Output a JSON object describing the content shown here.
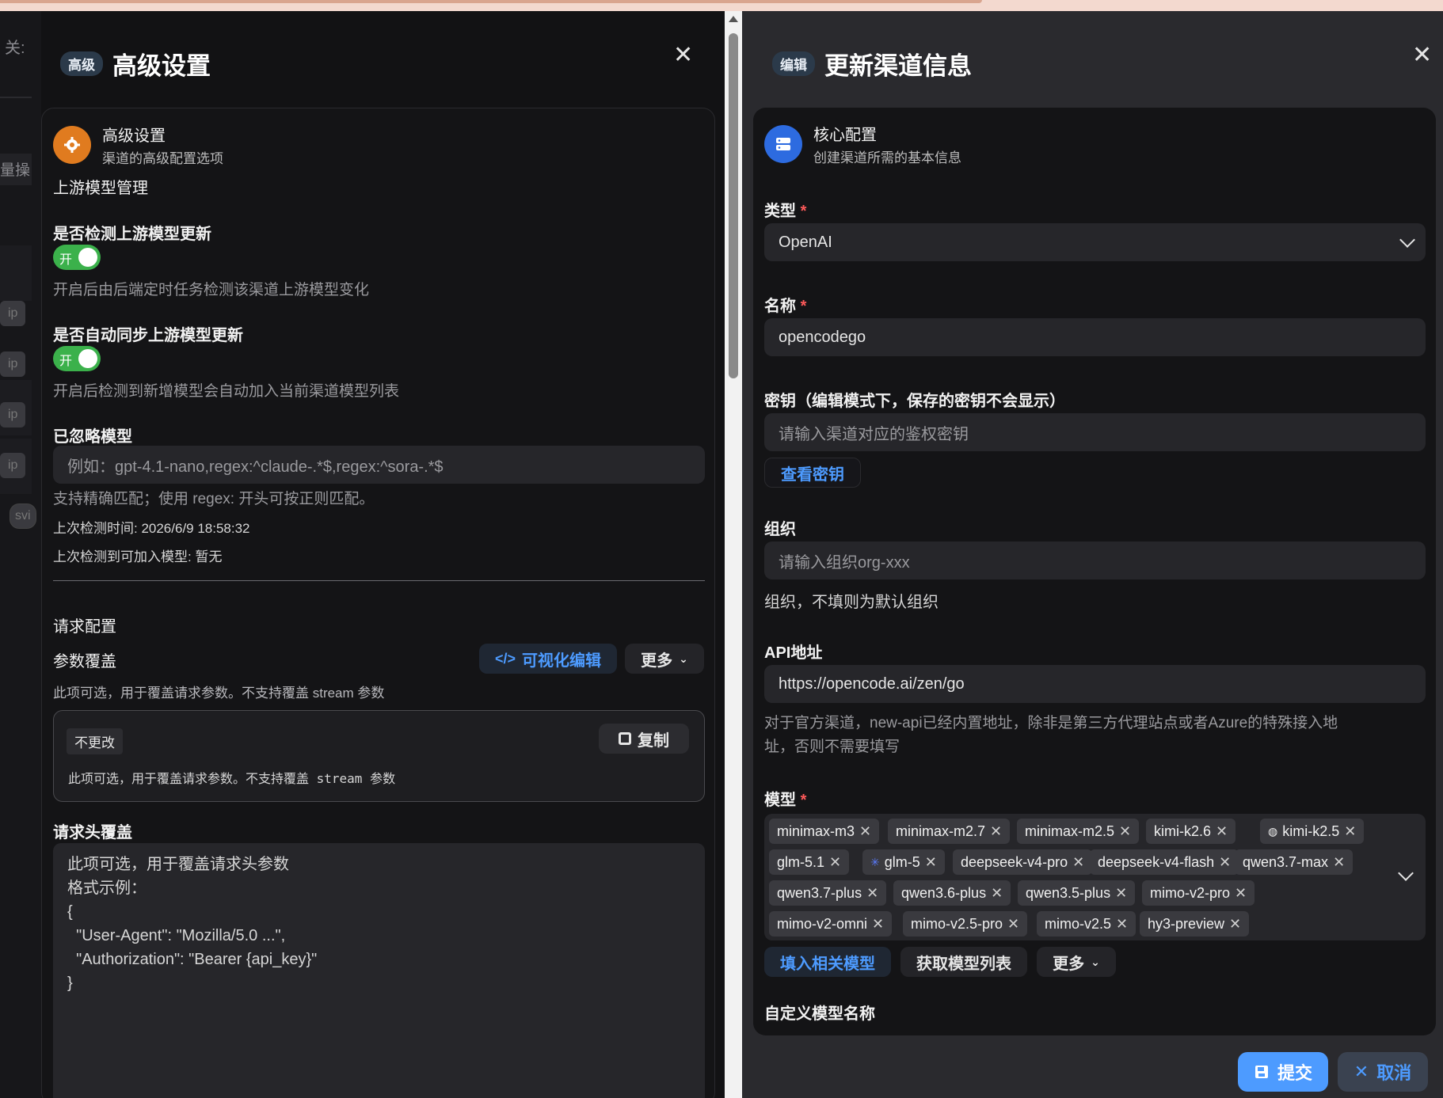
{
  "bg_app": {
    "title_frag": "关:",
    "side_frag": "量操",
    "chips": [
      "ip",
      "ip",
      "ip",
      "ip",
      "svi"
    ]
  },
  "left": {
    "tag": "高级",
    "title": "高级设置",
    "card_title": "高级设置",
    "card_sub": "渠道的高级配置选项",
    "upstream_section": "上游模型管理",
    "detect_label": "是否检测上游模型更新",
    "detect_toggle": "开",
    "detect_hint": "开启后由后端定时任务检测该渠道上游模型变化",
    "sync_label": "是否自动同步上游模型更新",
    "sync_toggle": "开",
    "sync_hint": "开启后检测到新增模型会自动加入当前渠道模型列表",
    "ignored_label": "已忽略模型",
    "ignored_placeholder": "例如：gpt-4.1-nano,regex:^claude-.*$,regex:^sora-.*$",
    "ignored_hint": "支持精确匹配；使用 regex: 开头可按正则匹配。",
    "last_check": "上次检测时间: 2026/6/9 18:58:32",
    "last_found": "上次检测到可加入模型: 暂无",
    "request_section": "请求配置",
    "param_override": "参数覆盖",
    "visual_edit": "可视化编辑",
    "more": "更多",
    "param_hint": "此项可选，用于覆盖请求参数。不支持覆盖 stream 参数",
    "nochange_tag": "不更改",
    "copy": "复制",
    "code_text": "此项可选，用于覆盖请求参数。不支持覆盖 stream 参数",
    "header_override": "请求头覆盖",
    "header_placeholder": "此项可选，用于覆盖请求头参数\n格式示例：\n{\n  \"User-Agent\": \"Mozilla/5.0 ...\",\n  \"Authorization\": \"Bearer {api_key}\"\n}"
  },
  "right": {
    "tag": "编辑",
    "title": "更新渠道信息",
    "card_title": "核心配置",
    "card_sub": "创建渠道所需的基本信息",
    "type_label": "类型",
    "type_value": "OpenAI",
    "name_label": "名称",
    "name_value": "opencodego",
    "key_label": "密钥（编辑模式下，保存的密钥不会显示）",
    "key_placeholder": "请输入渠道对应的鉴权密钥",
    "view_key": "查看密钥",
    "org_label": "组织",
    "org_placeholder": "请输入组织org-xxx",
    "org_hint": "组织，不填则为默认组织",
    "api_label": "API地址",
    "api_value": "https://opencode.ai/zen/go",
    "api_hint_1": "对于官方渠道，new-api已经内置地址，除非是第三方代理站点或者Azure的特殊接入地",
    "api_hint_2": "址，否则不需要填写",
    "models_label": "模型",
    "models": [
      "minimax-m3",
      "minimax-m2.7",
      "minimax-m2.5",
      "kimi-k2.6",
      "kimi-k2.5",
      "glm-5.1",
      "glm-5",
      "deepseek-v4-pro",
      "deepseek-v4-flash",
      "qwen3.7-max",
      "qwen3.7-plus",
      "qwen3.6-plus",
      "qwen3.5-plus",
      "mimo-v2-pro",
      "mimo-v2-omni",
      "mimo-v2.5-pro",
      "mimo-v2.5",
      "hy3-preview"
    ],
    "fill_models": "填入相关模型",
    "fetch_models": "获取模型列表",
    "more": "更多",
    "custom_model_label": "自定义模型名称",
    "submit": "提交",
    "cancel": "取消",
    "accent": "#4d9bff"
  }
}
